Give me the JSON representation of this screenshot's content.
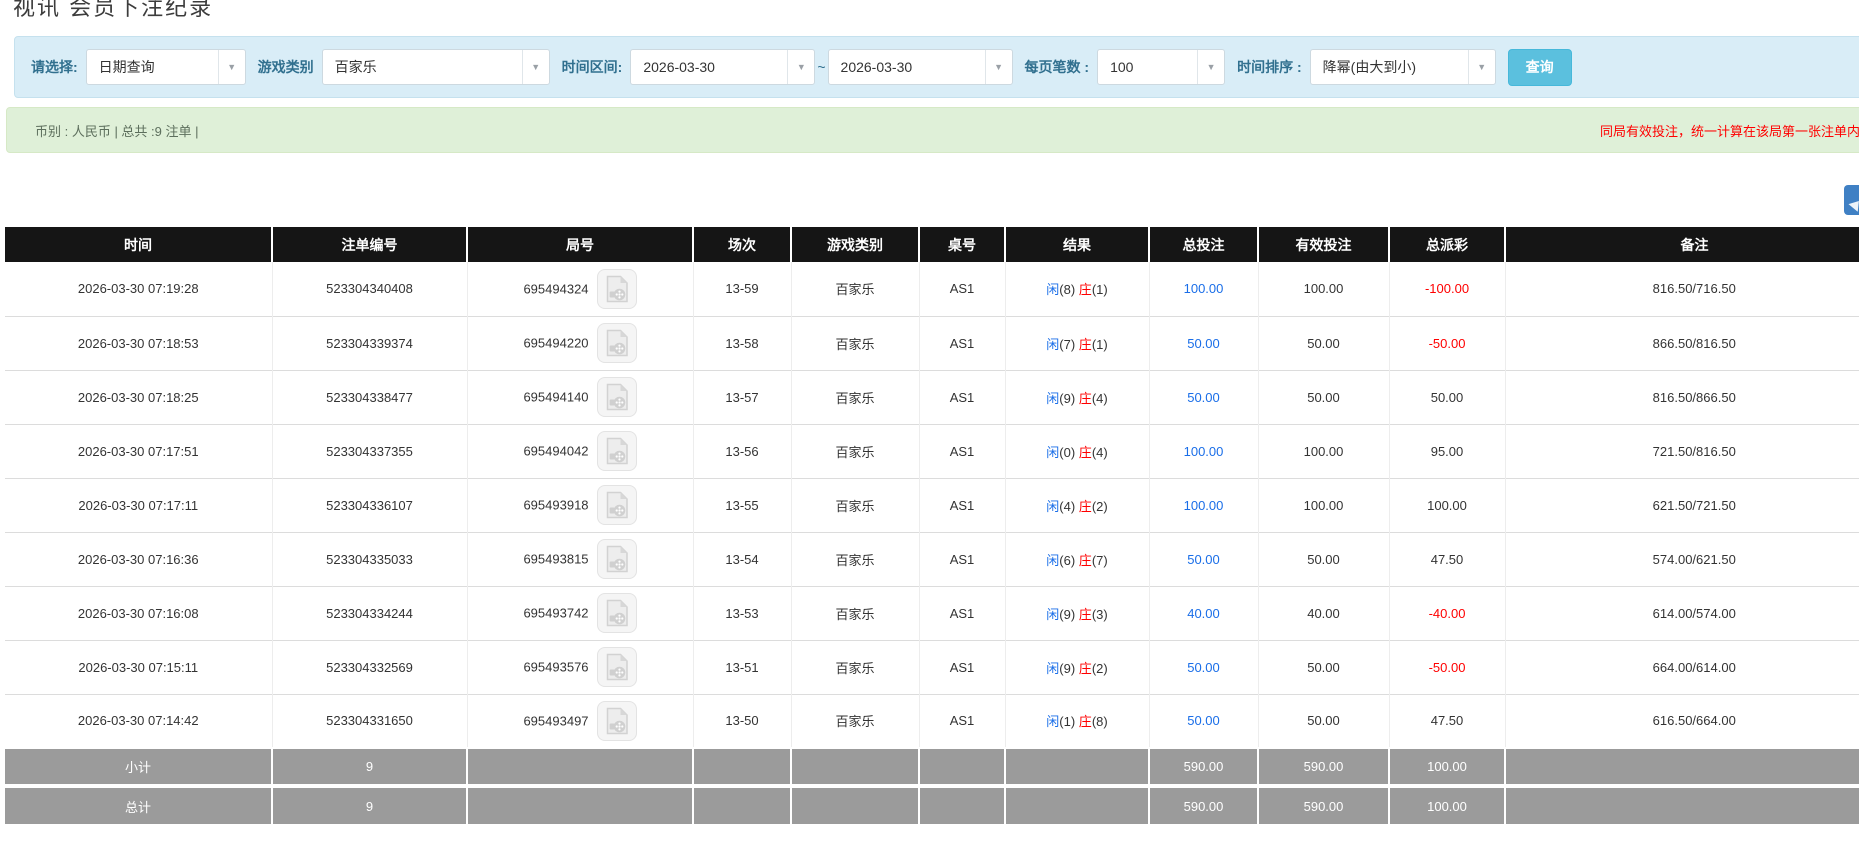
{
  "page": {
    "title": "视讯 会员下注纪录"
  },
  "colors": {
    "accent": "#5bc0de",
    "panel_bg": "#d9edf7",
    "success_bg": "#dff0d8",
    "link_blue": "#1a6ee8",
    "danger_red": "#ff0000",
    "header_black": "#151515",
    "footer_gray": "#9b9b9b"
  },
  "filters": {
    "select_label": "请选择:",
    "select_value": "日期查询",
    "game_type_label": "游戏类别",
    "game_type_value": "百家乐",
    "date_range_label": "时间区间:",
    "date_from": "2026-03-30",
    "tilde": "~",
    "date_to": "2026-03-30",
    "page_size_label": "每页笔数 :",
    "page_size_value": "100",
    "sort_label": "时间排序 :",
    "sort_value": "降幂(由大到小)",
    "search_button": "查询",
    "dropdown_glyph": "▼"
  },
  "summary": {
    "left": "币别 : 人民币 | 总共 :9 注单 |",
    "right": "同局有效投注，统一计算在该局第一张注单内 |"
  },
  "table": {
    "headers": [
      "时间",
      "注单编号",
      "局号",
      "场次",
      "游戏类别",
      "桌号",
      "结果",
      "总投注",
      "有效投注",
      "总派彩",
      "备注"
    ],
    "rows": [
      {
        "time": "2026-03-30 07:19:28",
        "bet_id": "523304340408",
        "round": "695494324",
        "session": "13-59",
        "game": "百家乐",
        "table_no": "AS1",
        "result_player": "闲",
        "result_player_num": "(8)",
        "result_banker": "庄",
        "result_banker_num": "(1)",
        "total_bet": "100.00",
        "valid_bet": "100.00",
        "payout": "-100.00",
        "note": "816.50/716.50"
      },
      {
        "time": "2026-03-30 07:18:53",
        "bet_id": "523304339374",
        "round": "695494220",
        "session": "13-58",
        "game": "百家乐",
        "table_no": "AS1",
        "result_player": "闲",
        "result_player_num": "(7)",
        "result_banker": "庄",
        "result_banker_num": "(1)",
        "total_bet": "50.00",
        "valid_bet": "50.00",
        "payout": "-50.00",
        "note": "866.50/816.50"
      },
      {
        "time": "2026-03-30 07:18:25",
        "bet_id": "523304338477",
        "round": "695494140",
        "session": "13-57",
        "game": "百家乐",
        "table_no": "AS1",
        "result_player": "闲",
        "result_player_num": "(9)",
        "result_banker": "庄",
        "result_banker_num": "(4)",
        "total_bet": "50.00",
        "valid_bet": "50.00",
        "payout": "50.00",
        "note": "816.50/866.50"
      },
      {
        "time": "2026-03-30 07:17:51",
        "bet_id": "523304337355",
        "round": "695494042",
        "session": "13-56",
        "game": "百家乐",
        "table_no": "AS1",
        "result_player": "闲",
        "result_player_num": "(0)",
        "result_banker": "庄",
        "result_banker_num": "(4)",
        "total_bet": "100.00",
        "valid_bet": "100.00",
        "payout": "95.00",
        "note": "721.50/816.50"
      },
      {
        "time": "2026-03-30 07:17:11",
        "bet_id": "523304336107",
        "round": "695493918",
        "session": "13-55",
        "game": "百家乐",
        "table_no": "AS1",
        "result_player": "闲",
        "result_player_num": "(4)",
        "result_banker": "庄",
        "result_banker_num": "(2)",
        "total_bet": "100.00",
        "valid_bet": "100.00",
        "payout": "100.00",
        "note": "621.50/721.50"
      },
      {
        "time": "2026-03-30 07:16:36",
        "bet_id": "523304335033",
        "round": "695493815",
        "session": "13-54",
        "game": "百家乐",
        "table_no": "AS1",
        "result_player": "闲",
        "result_player_num": "(6)",
        "result_banker": "庄",
        "result_banker_num": "(7)",
        "total_bet": "50.00",
        "valid_bet": "50.00",
        "payout": "47.50",
        "note": "574.00/621.50"
      },
      {
        "time": "2026-03-30 07:16:08",
        "bet_id": "523304334244",
        "round": "695493742",
        "session": "13-53",
        "game": "百家乐",
        "table_no": "AS1",
        "result_player": "闲",
        "result_player_num": "(9)",
        "result_banker": "庄",
        "result_banker_num": "(3)",
        "total_bet": "40.00",
        "valid_bet": "40.00",
        "payout": "-40.00",
        "note": "614.00/574.00"
      },
      {
        "time": "2026-03-30 07:15:11",
        "bet_id": "523304332569",
        "round": "695493576",
        "session": "13-51",
        "game": "百家乐",
        "table_no": "AS1",
        "result_player": "闲",
        "result_player_num": "(9)",
        "result_banker": "庄",
        "result_banker_num": "(2)",
        "total_bet": "50.00",
        "valid_bet": "50.00",
        "payout": "-50.00",
        "note": "664.00/614.00"
      },
      {
        "time": "2026-03-30 07:14:42",
        "bet_id": "523304331650",
        "round": "695493497",
        "session": "13-50",
        "game": "百家乐",
        "table_no": "AS1",
        "result_player": "闲",
        "result_player_num": "(1)",
        "result_banker": "庄",
        "result_banker_num": "(8)",
        "total_bet": "50.00",
        "valid_bet": "50.00",
        "payout": "47.50",
        "note": "616.50/664.00"
      }
    ],
    "subtotal": {
      "label": "小计",
      "count": "9",
      "total_bet": "590.00",
      "valid_bet": "590.00",
      "payout": "100.00"
    },
    "total": {
      "label": "总计",
      "count": "9",
      "total_bet": "590.00",
      "valid_bet": "590.00",
      "payout": "100.00"
    }
  }
}
